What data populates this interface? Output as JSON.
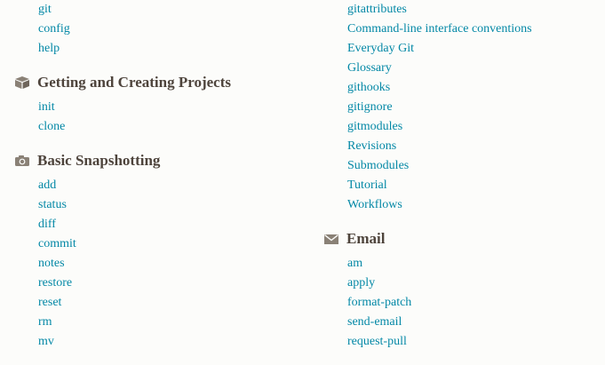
{
  "left": {
    "top_items": [
      "git",
      "config",
      "help"
    ],
    "sections": [
      {
        "icon": "box-icon",
        "title": "Getting and Creating Projects",
        "items": [
          "init",
          "clone"
        ]
      },
      {
        "icon": "camera-icon",
        "title": "Basic Snapshotting",
        "items": [
          "add",
          "status",
          "diff",
          "commit",
          "notes",
          "restore",
          "reset",
          "rm",
          "mv"
        ]
      }
    ]
  },
  "right": {
    "top_items": [
      "gitattributes",
      "Command-line interface conventions",
      "Everyday Git",
      "Glossary",
      "githooks",
      "gitignore",
      "gitmodules",
      "Revisions",
      "Submodules",
      "Tutorial",
      "Workflows"
    ],
    "sections": [
      {
        "icon": "envelope-icon",
        "title": "Email",
        "items": [
          "am",
          "apply",
          "format-patch",
          "send-email",
          "request-pull"
        ]
      }
    ]
  },
  "colors": {
    "link": "#0388a6",
    "heading": "#4e443c",
    "icon": "#8a8176",
    "background": "#fcfcfa"
  }
}
